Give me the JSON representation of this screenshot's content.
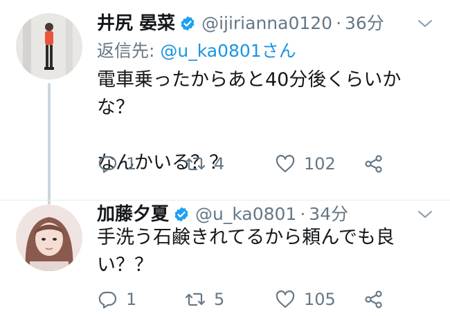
{
  "tweets": [
    {
      "display_name": "井尻 晏菜",
      "handle": "@ijirianna0120",
      "separator": "·",
      "time": "36分",
      "reply_prefix": "返信先: ",
      "reply_mention": "@u_ka0801さん",
      "text": "電車乗ったからあと40分後くらいかな？\n\nなんかいる？？",
      "replies": "1",
      "retweets": "4",
      "likes": "102"
    },
    {
      "display_name": "加藤夕夏",
      "handle": "@u_ka0801",
      "separator": "·",
      "time": "34分",
      "text": "手洗う石鹸きれてるから頼んでも良い？？",
      "replies": "1",
      "retweets": "5",
      "likes": "105"
    }
  ],
  "colors": {
    "verified": "#1da1f2",
    "mention": "#1b95e0",
    "secondary_text": "#657786",
    "thread_line": "#ccd6dd"
  },
  "icons": {
    "verified": "verified-badge-icon",
    "caret": "chevron-down-icon",
    "reply": "reply-icon",
    "retweet": "retweet-icon",
    "like": "heart-icon",
    "share": "share-icon"
  }
}
